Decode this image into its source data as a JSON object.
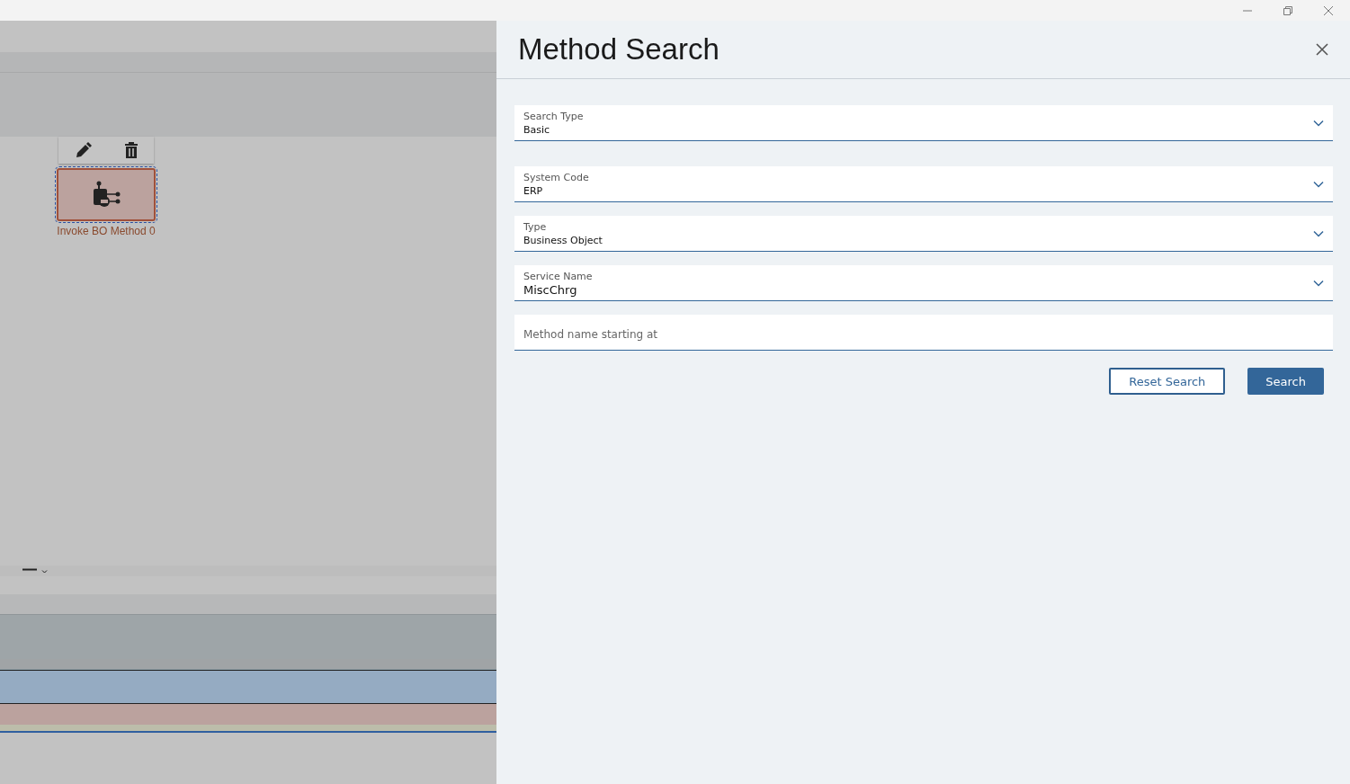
{
  "canvas": {
    "node": {
      "label": "Invoke BO Method 0",
      "selected": true
    }
  },
  "panel": {
    "title": "Method Search",
    "fields": [
      {
        "kind": "select",
        "label": "Search Type",
        "value": "Basic"
      },
      {
        "kind": "select",
        "label": "System Code",
        "value": "ERP"
      },
      {
        "kind": "select",
        "label": "Type",
        "value": "Business Object"
      },
      {
        "kind": "select",
        "label": "Service Name",
        "value": "MiscChrg",
        "large": true
      },
      {
        "kind": "input",
        "placeholder": "Method name starting at"
      }
    ],
    "buttons": [
      {
        "kind": "secondary",
        "label": "Reset Search"
      },
      {
        "kind": "primary",
        "label": "Search"
      }
    ]
  }
}
